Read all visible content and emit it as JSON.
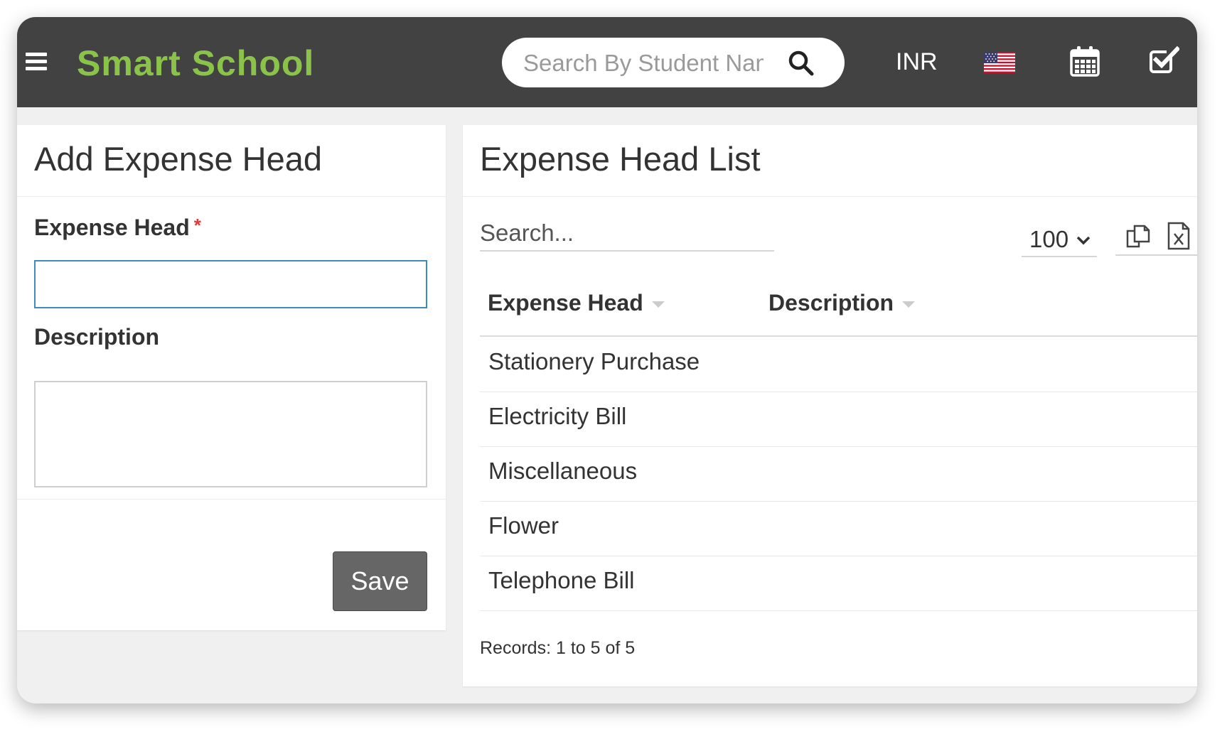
{
  "header": {
    "brand": "Smart School",
    "brand_color": "#8bc34a",
    "search_placeholder": "Search By Student Name",
    "currency": "INR",
    "icons": [
      "menu-icon",
      "search-icon",
      "us-flag-icon",
      "calendar-icon",
      "task-checkbox-icon"
    ]
  },
  "add_form": {
    "title": "Add Expense Head",
    "expense_head_label": "Expense Head",
    "required_mark": "*",
    "expense_head_value": "",
    "description_label": "Description",
    "description_value": "",
    "save_label": "Save"
  },
  "list": {
    "title": "Expense Head List",
    "search_placeholder": "Search...",
    "page_size": "100",
    "columns": [
      "Expense Head",
      "Description"
    ],
    "rows": [
      {
        "expense_head": "Stationery Purchase",
        "description": ""
      },
      {
        "expense_head": "Electricity Bill",
        "description": ""
      },
      {
        "expense_head": "Miscellaneous",
        "description": ""
      },
      {
        "expense_head": "Flower",
        "description": ""
      },
      {
        "expense_head": "Telephone Bill",
        "description": ""
      }
    ],
    "records": "Records: 1 to 5 of 5"
  }
}
